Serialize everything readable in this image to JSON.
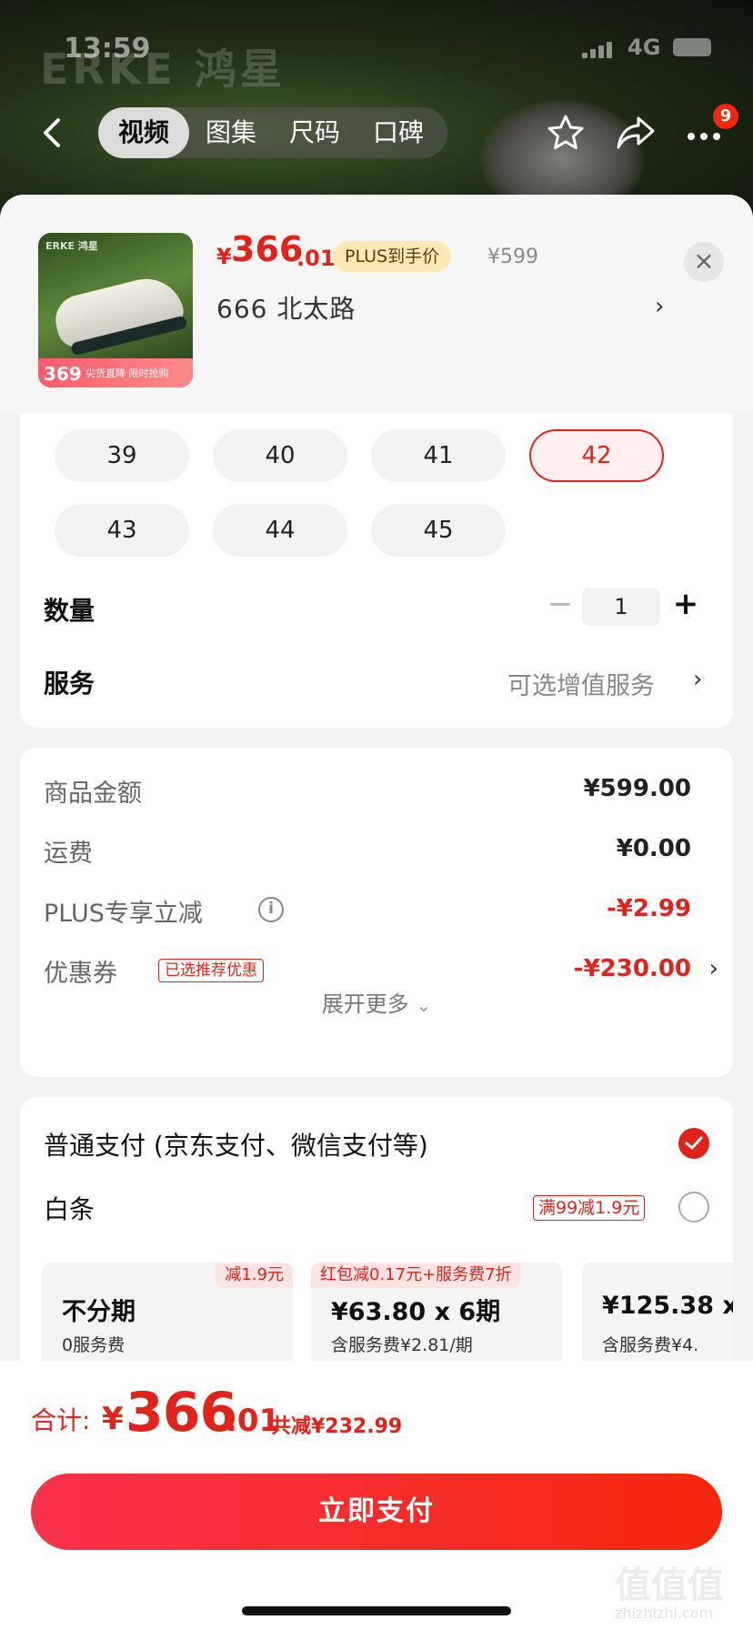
{
  "status_bar": {
    "time": "13:59",
    "network": "4G"
  },
  "brand_overlay": "ERKE 鸿星",
  "nav": {
    "tabs": [
      "视频",
      "图集",
      "尺码",
      "口碑"
    ],
    "active_tab": "视频",
    "more_badge": "9"
  },
  "product": {
    "image_promo_price": "369",
    "image_promo_text": "尖货直降 限时抢购",
    "image_logo": "ERKE 鸿星",
    "price_currency": "¥",
    "price_int": "366",
    "price_dec": ".01",
    "plus_tag": "PLUS到手价",
    "original_price": "¥599",
    "spec": "666  北太路",
    "close": "×"
  },
  "sizes": [
    {
      "label": "39",
      "selected": false
    },
    {
      "label": "40",
      "selected": false
    },
    {
      "label": "41",
      "selected": false
    },
    {
      "label": "42",
      "selected": true
    },
    {
      "label": "43",
      "selected": false
    },
    {
      "label": "44",
      "selected": false
    },
    {
      "label": "45",
      "selected": false
    }
  ],
  "quantity": {
    "label": "数量",
    "value": "1",
    "minus": "−",
    "plus": "+"
  },
  "service": {
    "label": "服务",
    "value": "可选增值服务"
  },
  "amounts": {
    "goods": {
      "label": "商品金额",
      "value": "¥599.00"
    },
    "shipping": {
      "label": "运费",
      "value": "¥0.00"
    },
    "plus_discount": {
      "label": "PLUS专享立减",
      "value": "-¥2.99"
    },
    "coupon": {
      "label": "优惠券",
      "tag": "已选推荐优惠",
      "value": "-¥230.00"
    },
    "expand": "展开更多"
  },
  "payment": {
    "normal": "普通支付 (京东支付、微信支付等)",
    "baitiao": "白条",
    "baitiao_tag": "满99减1.9元",
    "installments": [
      {
        "tag": "减1.9元",
        "main": "不分期",
        "sub": "0服务费"
      },
      {
        "tag": "红包减0.17元+服务费7折",
        "main": "¥63.80 x 6期",
        "sub": "含服务费¥2.81/期"
      },
      {
        "tag": "",
        "main": "¥125.38 x",
        "sub": "含服务费¥4."
      }
    ]
  },
  "total": {
    "label": "合计:",
    "currency": "¥",
    "int": "366",
    "dec": ".01",
    "saved": "共减¥232.99"
  },
  "pay_button": "立即支付",
  "watermark": {
    "text": "值值值",
    "url": "zhizhizhi.com"
  },
  "colors": {
    "accent": "#e2231a",
    "plus_tag_bg": "#fde9b3"
  }
}
